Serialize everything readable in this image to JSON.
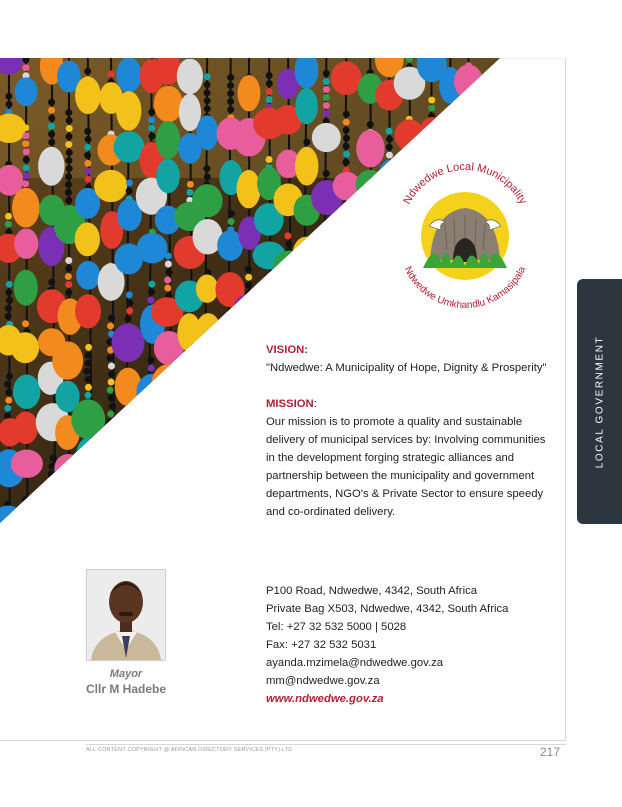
{
  "logo": {
    "top_text": "Ndwedwe Local Municipality",
    "bottom_text": "Ndwedwe Umkhandlu Kamasipala"
  },
  "side_tab": {
    "label": "LOCAL GOVERNMENT"
  },
  "vision": {
    "heading": "VISION:",
    "text": "\"Ndwedwe: A Municipality of Hope, Dignity & Prosperity\""
  },
  "mission": {
    "heading": "MISSION",
    "colon": ":",
    "text": "Our mission is to promote a quality and sustainable delivery of municipal services by: Involving communities in the development forging strategic alliances and partnership between the municipality and government departments, NGO's & Private Sector to ensure speedy and co-ordinated delivery."
  },
  "contact": {
    "address": "P100 Road, Ndwedwe, 4342, South Africa",
    "postal": "Private Bag X503, Ndwedwe, 4342, South Africa",
    "tel": "Tel: +27 32 532 5000 | 5028",
    "fax": "Fax: +27 32 532 5031",
    "email1": "ayanda.mzimela@ndwedwe.gov.za",
    "email2": "mm@ndwedwe.gov.za",
    "website": "www.ndwedwe.gov.za"
  },
  "mayor": {
    "role": "Mayor",
    "name": "Cllr M Hadebe"
  },
  "footer": {
    "copyright": "ALL CONTENT COPYRIGHT @ AFRICAN DIRECTORY SERVICES (PTY) LTD",
    "page_number": "217"
  },
  "colors": {
    "accent": "#b32033",
    "tab_bg": "#2c363f"
  }
}
